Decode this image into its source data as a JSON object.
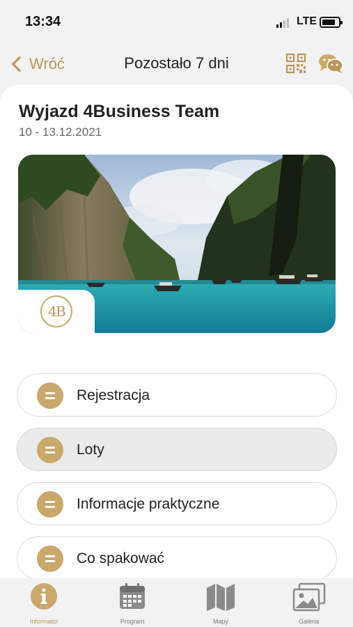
{
  "status_bar": {
    "time": "13:34",
    "network": "LTE"
  },
  "nav": {
    "back_label": "Wróć",
    "title": "Pozostało 7 dni",
    "icons": [
      "chevron-left-icon",
      "qr-code-icon",
      "chat-bubbles-icon"
    ]
  },
  "trip": {
    "title": "Wyjazd 4Business Team",
    "dates": "10 - 13.12.2021",
    "logo_text": "4B"
  },
  "menu": {
    "items": [
      {
        "label": "Rejestracja",
        "icon": "menu-lines-icon",
        "active": false
      },
      {
        "label": "Loty",
        "icon": "menu-lines-icon",
        "active": true
      },
      {
        "label": "Informacje praktyczne",
        "icon": "menu-lines-icon",
        "active": false
      },
      {
        "label": "Co spakować",
        "icon": "menu-lines-icon",
        "active": false
      }
    ]
  },
  "tabs": [
    {
      "label": "Informator",
      "icon": "info-icon",
      "active": true
    },
    {
      "label": "Program",
      "icon": "calendar-icon",
      "active": false
    },
    {
      "label": "Mapy",
      "icon": "map-icon",
      "active": false
    },
    {
      "label": "Galeria",
      "icon": "gallery-icon",
      "active": false
    }
  ],
  "colors": {
    "accent": "#c9a86c",
    "accent_text": "#b9955a",
    "background": "#f2f2f2",
    "card": "#ffffff",
    "tab_icon_gray": "#8a8a8a"
  }
}
